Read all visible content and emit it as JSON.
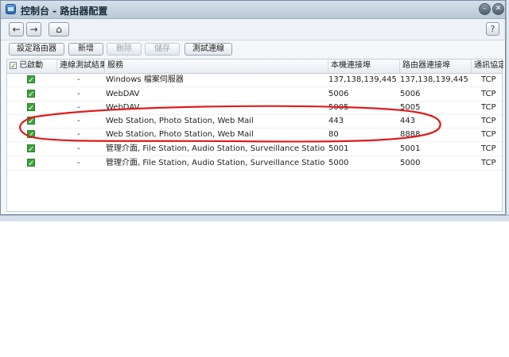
{
  "window": {
    "title": "控制台 - 路由器配置"
  },
  "nav": {
    "back": "←",
    "forward": "→",
    "home": "⌂",
    "help": "?"
  },
  "toolbar": {
    "buttons": [
      {
        "label": "設定路由器",
        "enabled": true
      },
      {
        "label": "新增",
        "enabled": true
      },
      {
        "label": "刪除",
        "enabled": false
      },
      {
        "label": "儲存",
        "enabled": false
      },
      {
        "label": "測試連線",
        "enabled": true
      }
    ]
  },
  "table": {
    "columns": [
      "已啟動",
      "連線測試結果",
      "服務",
      "本機連接埠",
      "路由器連接埠",
      "通訊協定"
    ],
    "rows": [
      {
        "enabled": true,
        "test": "-",
        "service": "Windows 檔案伺服器",
        "local": "137,138,139,445",
        "router": "137,138,139,445",
        "protocol": "TCP"
      },
      {
        "enabled": true,
        "test": "-",
        "service": "WebDAV",
        "local": "5006",
        "router": "5006",
        "protocol": "TCP"
      },
      {
        "enabled": true,
        "test": "-",
        "service": "WebDAV",
        "local": "5005",
        "router": "5005",
        "protocol": "TCP"
      },
      {
        "enabled": true,
        "test": "-",
        "service": "Web Station, Photo Station, Web Mail",
        "local": "443",
        "router": "443",
        "protocol": "TCP"
      },
      {
        "enabled": true,
        "test": "-",
        "service": "Web Station, Photo Station, Web Mail",
        "local": "80",
        "router": "8888",
        "protocol": "TCP"
      },
      {
        "enabled": true,
        "test": "-",
        "service": "管理介面, File Station, Audio Station, Surveillance Station, ...",
        "local": "5001",
        "router": "5001",
        "protocol": "TCP"
      },
      {
        "enabled": true,
        "test": "-",
        "service": "管理介面, File Station, Audio Station, Surveillance Station, ...",
        "local": "5000",
        "router": "5000",
        "protocol": "TCP"
      }
    ]
  },
  "colors": {
    "annotation": "#e01b1b",
    "check": "#3aa53a"
  }
}
